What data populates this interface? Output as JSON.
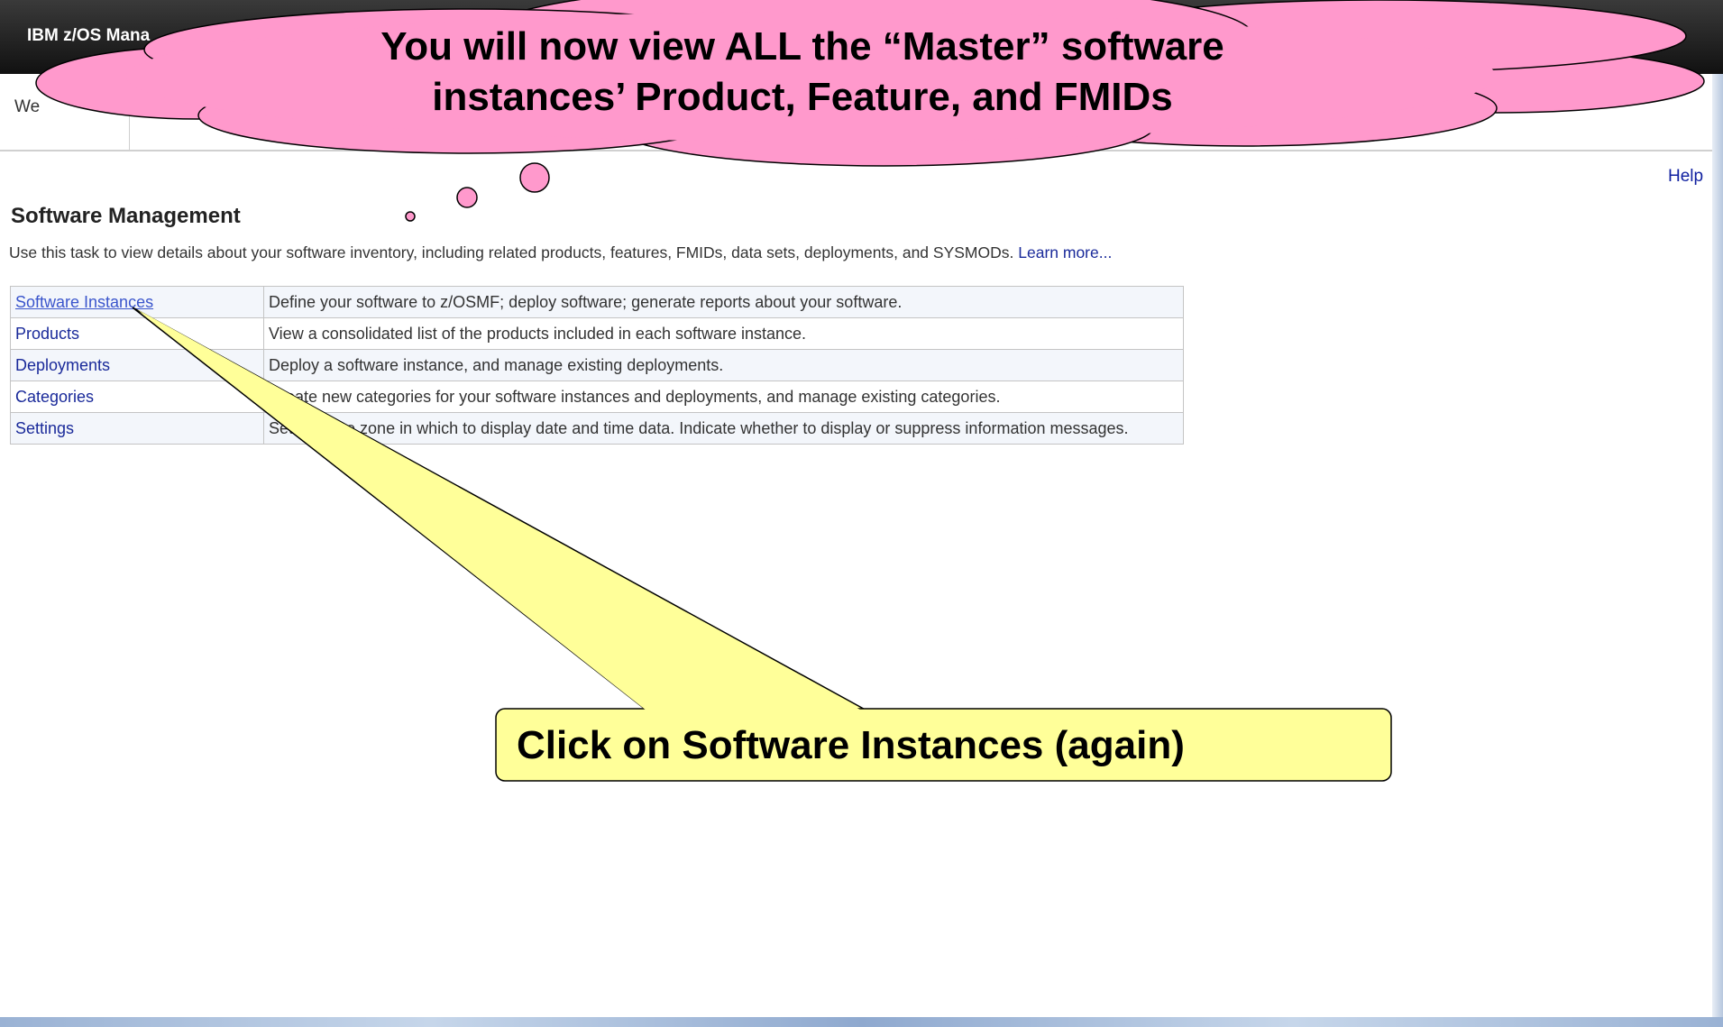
{
  "app": {
    "title": "IBM z/OS Mana"
  },
  "tabs": {
    "welcome_label": "We"
  },
  "help_label": "Help",
  "page": {
    "title": "Software Management",
    "description": "Use this task to view details about your software inventory, including related products, features, FMIDs, data sets, deployments, and SYSMODs.",
    "learn_more": "Learn more..."
  },
  "tasks": [
    {
      "name": "Software Instances",
      "description": "Define your software to z/OSMF; deploy software; generate reports about your software."
    },
    {
      "name": "Products",
      "description": "View a consolidated list of the products included in each software instance."
    },
    {
      "name": "Deployments",
      "description": "Deploy a software instance, and manage existing deployments."
    },
    {
      "name": "Categories",
      "description": "Create new categories for your software instances and deployments, and manage existing categories."
    },
    {
      "name": "Settings",
      "description": "Set the time zone in which to display date and time data. Indicate whether to display or suppress information messages."
    }
  ],
  "annotations": {
    "cloud_line1": "You will now view ALL the “Master” software",
    "cloud_line2": "instances’ Product, Feature, and FMIDs",
    "callout": "Click on Software Instances (again)",
    "cloud_color": "#ff99cc",
    "callout_color": "#ffff99"
  }
}
